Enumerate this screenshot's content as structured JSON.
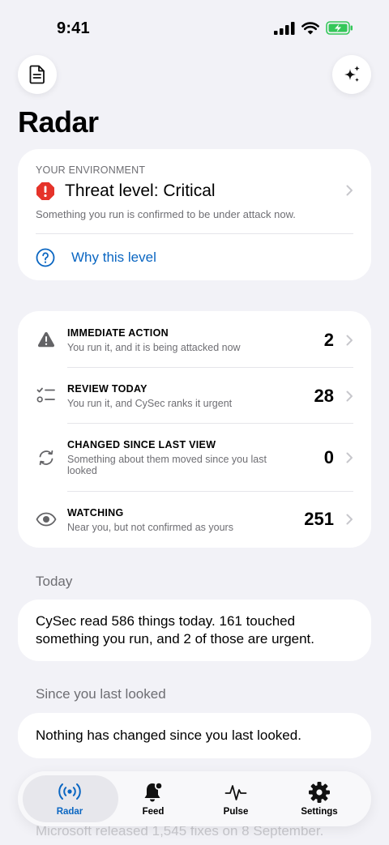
{
  "status_bar": {
    "time": "9:41"
  },
  "header": {
    "title": "Radar",
    "doc_icon": "document-icon",
    "sparkle_icon": "sparkles-icon"
  },
  "environment": {
    "eyebrow": "YOUR ENVIRONMENT",
    "title": "Threat level: Critical",
    "subtitle": "Something you run is confirmed to be under attack now.",
    "why_label": "Why this level",
    "alert_color": "#e5332a"
  },
  "rows": [
    {
      "title": "IMMEDIATE ACTION",
      "subtitle": "You run it, and it is being attacked now",
      "count": "2",
      "icon": "warning-icon"
    },
    {
      "title": "REVIEW TODAY",
      "subtitle": "You run it, and CySec ranks it urgent",
      "count": "28",
      "icon": "checklist-icon"
    },
    {
      "title": "CHANGED SINCE LAST VIEW",
      "subtitle": "Something about them moved since you last looked",
      "count": "0",
      "icon": "refresh-icon"
    },
    {
      "title": "WATCHING",
      "subtitle": "Near you, but not confirmed as yours",
      "count": "251",
      "icon": "eye-icon"
    }
  ],
  "today": {
    "heading": "Today",
    "text": "CySec read 586 things today. 161 touched something you run, and 2 of those are urgent."
  },
  "since": {
    "heading": "Since you last looked",
    "text": "Nothing has changed since you last looked."
  },
  "peek_text": "Microsoft released 1,545 fixes on 8 September.",
  "tabs": [
    {
      "label": "Radar",
      "icon": "radar-icon",
      "active": true
    },
    {
      "label": "Feed",
      "icon": "bell-icon",
      "active": false
    },
    {
      "label": "Pulse",
      "icon": "pulse-icon",
      "active": false
    },
    {
      "label": "Settings",
      "icon": "gear-icon",
      "active": false
    }
  ],
  "colors": {
    "accent": "#0a66c2",
    "background": "#f2f2f7",
    "battery": "#34c759"
  }
}
